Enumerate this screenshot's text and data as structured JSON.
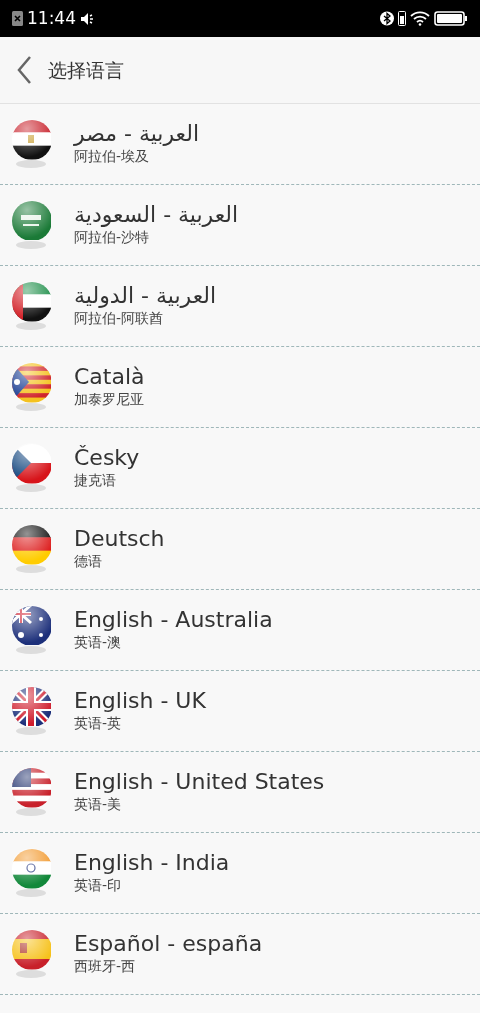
{
  "status_bar": {
    "time": "11:44"
  },
  "header": {
    "title": "选择语言"
  },
  "languages": [
    {
      "name": "العربية - مصر",
      "subtitle": "阿拉伯-埃及"
    },
    {
      "name": "العربية - السعودية",
      "subtitle": "阿拉伯-沙特"
    },
    {
      "name": "العربية - الدولية",
      "subtitle": "阿拉伯-阿联酋"
    },
    {
      "name": "Català",
      "subtitle": "加泰罗尼亚"
    },
    {
      "name": "Česky",
      "subtitle": "捷克语"
    },
    {
      "name": "Deutsch",
      "subtitle": "德语"
    },
    {
      "name": "English - Australia",
      "subtitle": "英语-澳"
    },
    {
      "name": "English - UK",
      "subtitle": "英语-英"
    },
    {
      "name": "English - United States",
      "subtitle": "英语-美"
    },
    {
      "name": "English - India",
      "subtitle": "英语-印"
    },
    {
      "name": "Español - españa",
      "subtitle": "西班牙-西"
    }
  ]
}
